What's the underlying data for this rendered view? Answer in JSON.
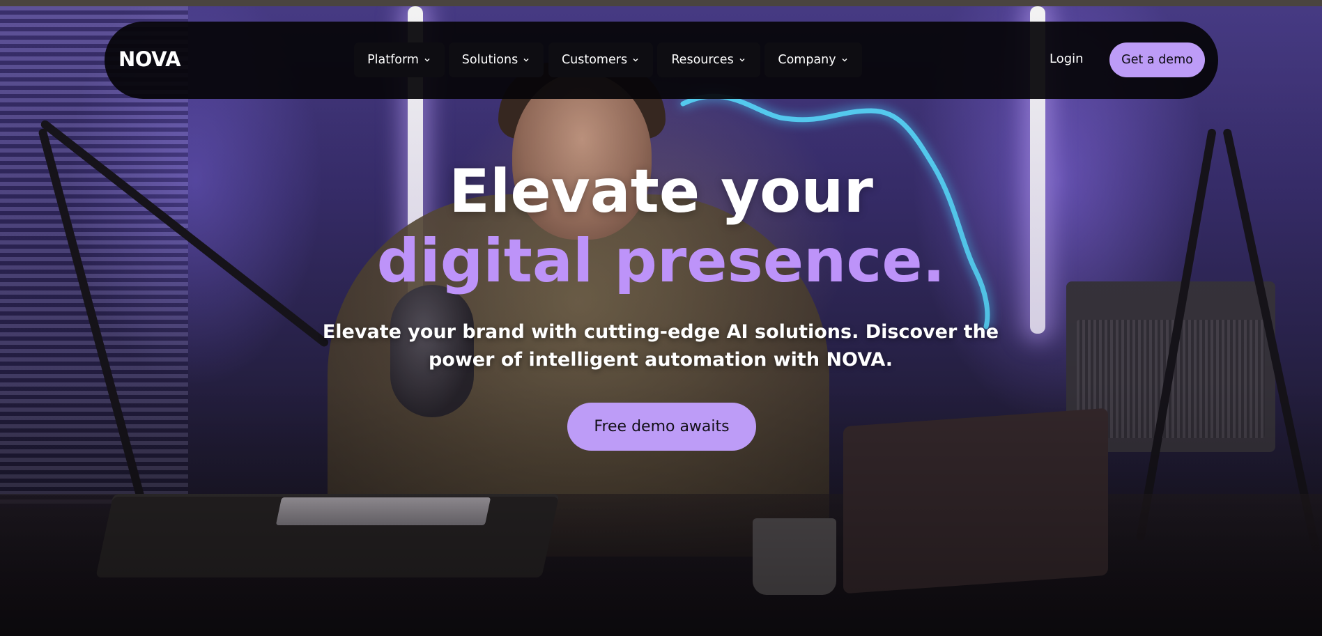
{
  "brand": {
    "logo": "NOVA"
  },
  "nav": {
    "items": [
      {
        "label": "Platform"
      },
      {
        "label": "Solutions"
      },
      {
        "label": "Customers"
      },
      {
        "label": "Resources"
      },
      {
        "label": "Company"
      }
    ],
    "login_label": "Login",
    "demo_label": "Get a demo"
  },
  "hero": {
    "title_line1": "Elevate your",
    "title_line2": "digital presence.",
    "subtitle_line1": "Elevate your brand with cutting-edge AI solutions. Discover the",
    "subtitle_line2": "power of intelligent automation with NOVA.",
    "cta_label": "Free demo awaits"
  },
  "colors": {
    "accent": "#bd9cf7",
    "accent_text": "#bd93f9",
    "nav_bg": "#060509"
  },
  "icons": {
    "menu_chevron": "chevron-down-icon"
  }
}
